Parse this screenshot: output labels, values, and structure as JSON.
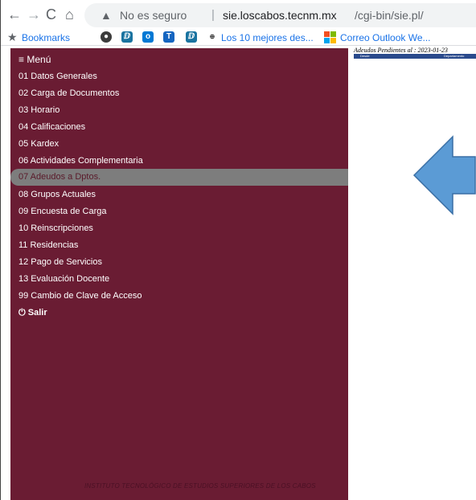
{
  "browser": {
    "nav": {
      "back": "←",
      "forward": "→",
      "reload": "C",
      "home": "⌂"
    },
    "security_label": "No es seguro",
    "url_host": "sie.loscabos.tecnm.mx",
    "url_path": "/cgi-bin/sie.pl/"
  },
  "bookmarks": {
    "label": "Bookmarks",
    "link1": "Los 10 mejores des...",
    "link2": "Correo Outlook We..."
  },
  "sidebar": {
    "title": "Menú",
    "items": [
      "01 Datos Generales",
      "02 Carga de Documentos",
      "03 Horario",
      "04 Calificaciones",
      "05 Kardex",
      "06 Actividades Complementaria",
      "07 Adeudos a Dptos.",
      "08 Grupos Actuales",
      "09 Encuesta de Carga",
      "10 Reinscripciones",
      "11 Residencias",
      "12 Pago de Servicios",
      "13 Evaluación Docente",
      "99 Cambio de Clave de Acceso"
    ],
    "exit": "Salir",
    "footer": "INSTITUTO TECNOLÓGICO DE ESTUDIOS SUPERIORES DE LOS CABOS"
  },
  "content": {
    "heading": "Adeudos Pendientes al : 2023-01-23",
    "columns": [
      "Desde",
      "Departamento"
    ]
  },
  "colors": {
    "sidebar": "#6a1c33",
    "active": "#7d7d7d",
    "arrow": "#5b9bd5",
    "table_header": "#2a4a8c"
  }
}
